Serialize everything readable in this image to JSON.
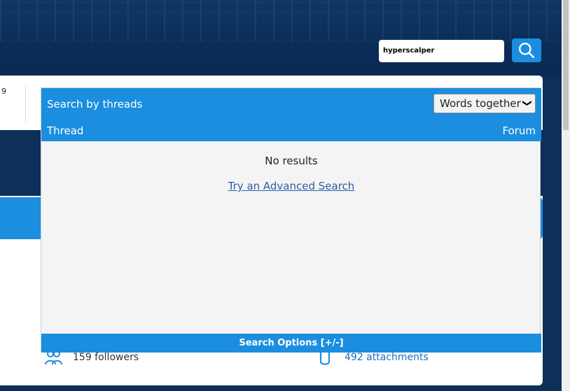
{
  "header": {
    "search_value": "hyperscalper"
  },
  "background": {
    "stat_fragment": "9",
    "followers": "159 followers",
    "attachments": "492 attachments"
  },
  "dropdown": {
    "title": "Search by threads",
    "mode_selected": "Words together",
    "column_thread": "Thread",
    "column_forum": "Forum",
    "empty_message": "No results",
    "advanced_link": "Try an Advanced Search",
    "footer_label": "Search Options [+/-]"
  },
  "colors": {
    "accent": "#1b8ee0",
    "header_bg": "#0d2f5a"
  }
}
